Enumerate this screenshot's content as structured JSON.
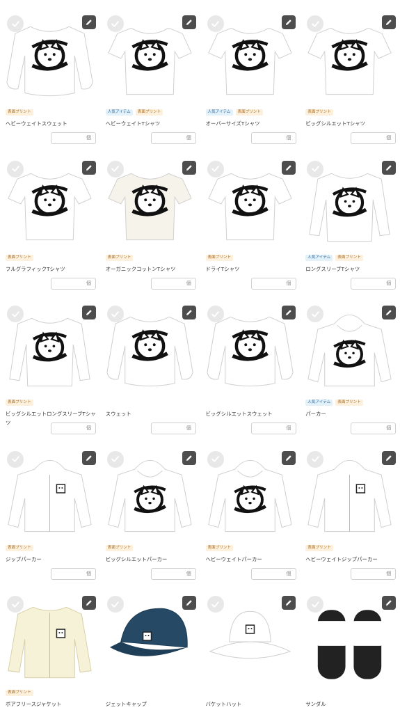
{
  "icons": {
    "check": "check-circle-icon",
    "edit": "pencil-icon"
  },
  "colors": {
    "popular_badge_bg": "#e3f1fb",
    "print_badge_bg": "#fdf0dc",
    "edit_button": "#4d4d4d"
  },
  "unit_label": "個",
  "products": [
    {
      "name": "ヘビーウェイトスウェット",
      "badges": [
        {
          "text": "表面プリント",
          "kind": "print"
        }
      ],
      "shape": "sweat",
      "color": "#ffffff",
      "graphic": "large",
      "qty": true
    },
    {
      "name": "ヘビーウェイトTシャツ",
      "badges": [
        {
          "text": "人気アイテム",
          "kind": "popular"
        },
        {
          "text": "表面プリント",
          "kind": "print"
        }
      ],
      "shape": "tee",
      "color": "#ffffff",
      "graphic": "large",
      "qty": true
    },
    {
      "name": "オーバーサイズTシャツ",
      "badges": [
        {
          "text": "人気アイテム",
          "kind": "popular"
        },
        {
          "text": "表面プリント",
          "kind": "print"
        }
      ],
      "shape": "tee",
      "color": "#ffffff",
      "graphic": "large",
      "qty": true
    },
    {
      "name": "ビッグシルエットTシャツ",
      "badges": [
        {
          "text": "表面プリント",
          "kind": "print"
        }
      ],
      "shape": "tee",
      "color": "#ffffff",
      "graphic": "large",
      "qty": true
    },
    {
      "name": "フルグラフィックTシャツ",
      "badges": [
        {
          "text": "表面プリント",
          "kind": "print"
        }
      ],
      "shape": "tee",
      "color": "#ffffff",
      "graphic": "large",
      "qty": true
    },
    {
      "name": "オーガニックコットンTシャツ",
      "badges": [
        {
          "text": "表面プリント",
          "kind": "print"
        }
      ],
      "shape": "tee",
      "color": "#f5f3ea",
      "graphic": "large",
      "qty": true
    },
    {
      "name": "ドライTシャツ",
      "badges": [
        {
          "text": "表面プリント",
          "kind": "print"
        }
      ],
      "shape": "tee",
      "color": "#ffffff",
      "graphic": "large",
      "qty": true
    },
    {
      "name": "ロングスリーブTシャツ",
      "badges": [
        {
          "text": "人気アイテム",
          "kind": "popular"
        },
        {
          "text": "表面プリント",
          "kind": "print"
        }
      ],
      "shape": "longsleeve",
      "color": "#ffffff",
      "graphic": "large",
      "qty": true
    },
    {
      "name": "ビッグシルエットロングスリーブTシャツ",
      "badges": [
        {
          "text": "表面プリント",
          "kind": "print"
        }
      ],
      "shape": "longsleeve",
      "color": "#ffffff",
      "graphic": "large",
      "qty": true
    },
    {
      "name": "スウェット",
      "badges": [],
      "shape": "sweat",
      "color": "#ffffff",
      "graphic": "large",
      "qty": true
    },
    {
      "name": "ビッグシルエットスウェット",
      "badges": [],
      "shape": "sweat",
      "color": "#ffffff",
      "graphic": "large",
      "qty": true
    },
    {
      "name": "パーカー",
      "badges": [
        {
          "text": "人気アイテム",
          "kind": "popular"
        },
        {
          "text": "表面プリント",
          "kind": "print"
        }
      ],
      "shape": "hoodie",
      "color": "#ffffff",
      "graphic": "large",
      "qty": true
    },
    {
      "name": "ジップパーカー",
      "badges": [
        {
          "text": "表面プリント",
          "kind": "print"
        }
      ],
      "shape": "ziphoodie",
      "color": "#ffffff",
      "graphic": "small",
      "qty": true
    },
    {
      "name": "ビッグシルエットパーカー",
      "badges": [
        {
          "text": "表面プリント",
          "kind": "print"
        }
      ],
      "shape": "hoodie",
      "color": "#ffffff",
      "graphic": "large",
      "qty": true
    },
    {
      "name": "ヘビーウェイトパーカー",
      "badges": [
        {
          "text": "表面プリント",
          "kind": "print"
        }
      ],
      "shape": "hoodie",
      "color": "#ffffff",
      "graphic": "large",
      "qty": true
    },
    {
      "name": "ヘビーウェイトジップパーカー",
      "badges": [
        {
          "text": "表面プリント",
          "kind": "print"
        }
      ],
      "shape": "ziphoodie",
      "color": "#ffffff",
      "graphic": "small",
      "qty": true
    },
    {
      "name": "ボアフリースジャケット",
      "badges": [
        {
          "text": "表面プリント",
          "kind": "print"
        }
      ],
      "shape": "fleece",
      "color": "#f6f2d8",
      "graphic": "small",
      "qty": false
    },
    {
      "name": "ジェットキャップ",
      "badges": [],
      "shape": "cap",
      "color": "#264a66",
      "graphic": "small",
      "qty": false
    },
    {
      "name": "バケットハット",
      "badges": [],
      "shape": "bucket",
      "color": "#ffffff",
      "graphic": "small",
      "qty": false
    },
    {
      "name": "サンダル",
      "badges": [],
      "shape": "sandal",
      "color": "#1a1a1a",
      "graphic": "small",
      "qty": false
    }
  ]
}
